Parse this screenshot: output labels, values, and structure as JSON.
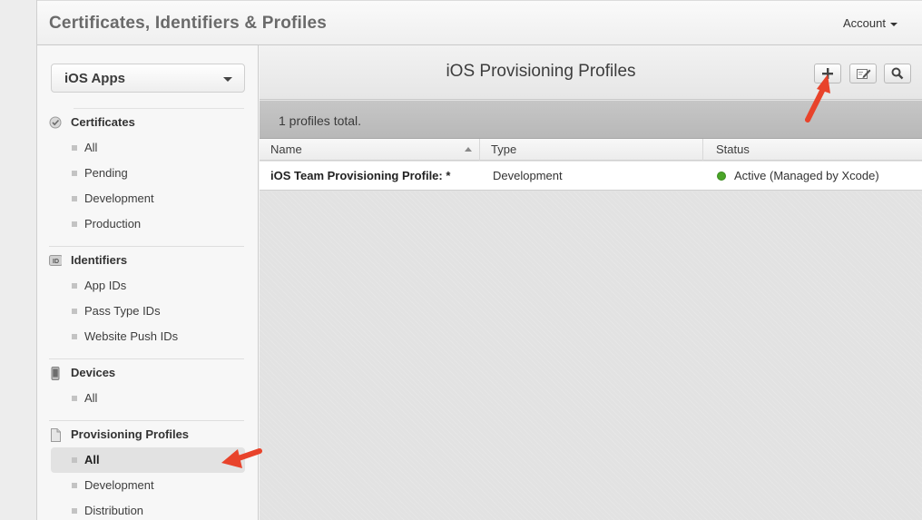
{
  "header": {
    "title": "Certificates, Identifiers & Profiles",
    "account_label": "Account"
  },
  "sidebar": {
    "platform": "iOS Apps",
    "sections": [
      {
        "title": "Certificates",
        "icon": "certificate-icon",
        "items": [
          "All",
          "Pending",
          "Development",
          "Production"
        ]
      },
      {
        "title": "Identifiers",
        "icon": "id-badge-icon",
        "items": [
          "App IDs",
          "Pass Type IDs",
          "Website Push IDs"
        ]
      },
      {
        "title": "Devices",
        "icon": "iphone-icon",
        "items": [
          "All"
        ]
      },
      {
        "title": "Provisioning Profiles",
        "icon": "document-icon",
        "items": [
          "All",
          "Development",
          "Distribution"
        ]
      }
    ],
    "active_item": "Provisioning Profiles / All"
  },
  "main": {
    "title": "iOS Provisioning Profiles",
    "toolbar": {
      "add_icon": "plus-icon",
      "edit_icon": "edit-icon",
      "search_icon": "search-icon"
    },
    "summary": "1 profiles total.",
    "columns": [
      "Name",
      "Type",
      "Status"
    ],
    "rows": [
      {
        "name": "iOS Team Provisioning Profile: *",
        "type": "Development",
        "status": "Active (Managed by Xcode)"
      }
    ]
  },
  "colors": {
    "status_active": "#4aa527",
    "annotation_arrow": "#e8432b"
  }
}
